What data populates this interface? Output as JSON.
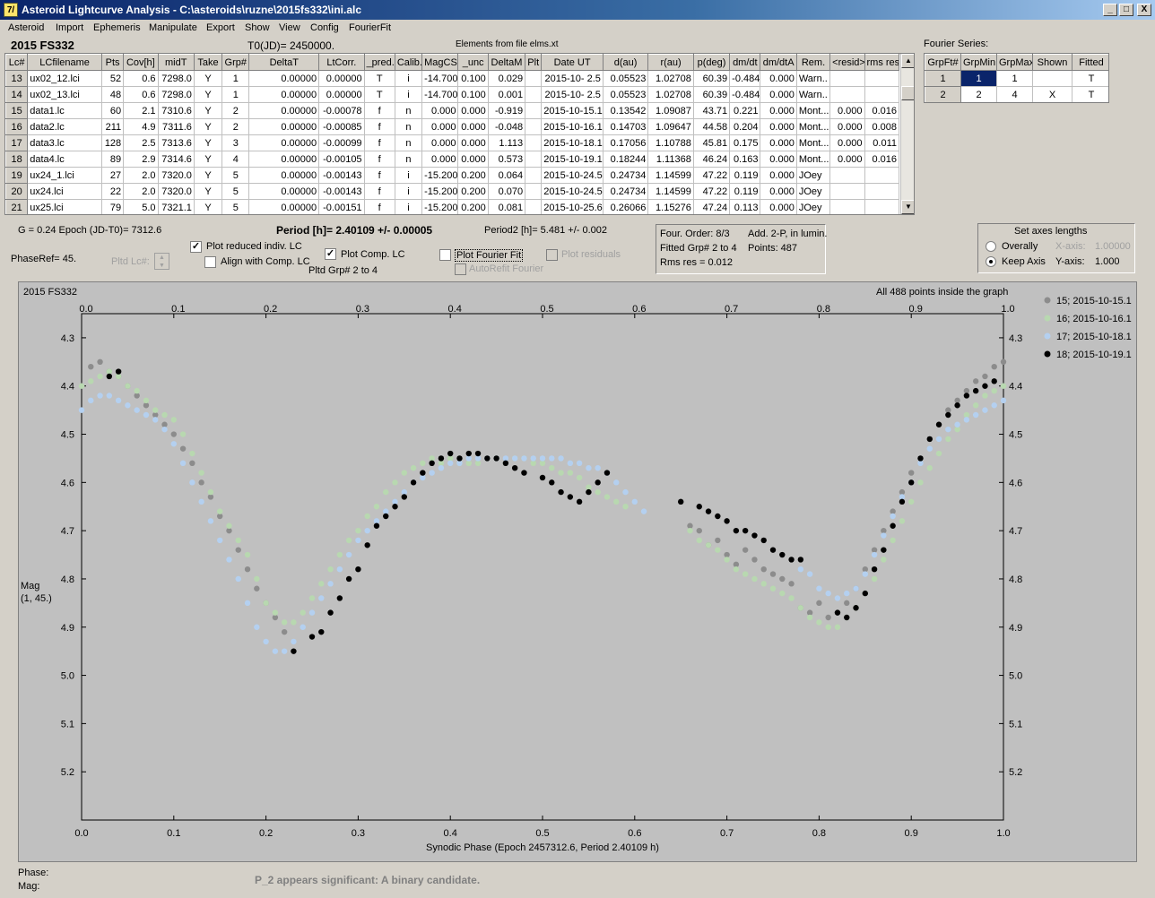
{
  "window": {
    "title": "Asteroid Lightcurve Analysis - C:\\asteroids\\ruzne\\2015fs332\\ini.alc",
    "icon": "7/",
    "minimize": "_",
    "maximize": "□",
    "close": "X"
  },
  "menu": [
    "Asteroid",
    "Import",
    "Ephemeris",
    "Manipulate",
    "Export",
    "Show",
    "View",
    "Config",
    "FourierFit"
  ],
  "header": {
    "asteroid_name": "2015 FS332",
    "t0": "T0(JD)= 2450000.",
    "elements": "Elements from file elms.xt"
  },
  "lc_table": {
    "columns": [
      "Lc#",
      "LCfilename",
      "Pts",
      "Cov[h]",
      "midT",
      "Take",
      "Grp#",
      "DeltaT",
      "LtCorr.",
      "_pred.",
      "Calib.",
      "MagCS",
      "_unc",
      "DeltaM",
      "Plt",
      "Date UT",
      "d(au)",
      "r(au)",
      "p(deg)",
      "dm/dt",
      "dm/dtA",
      "Rem.",
      "<resid>",
      "rms res"
    ],
    "rows": [
      [
        "13",
        "ux02_12.lci",
        "52",
        "0.6",
        "7298.0",
        "Y",
        "1",
        "0.00000",
        "0.00000",
        "T",
        "i",
        "-14.700",
        "0.100",
        "0.029",
        "",
        "2015-10- 2.5",
        "0.05523",
        "1.02708",
        "60.39",
        "-0.484",
        "0.000",
        "Warn..",
        "",
        ""
      ],
      [
        "14",
        "ux02_13.lci",
        "48",
        "0.6",
        "7298.0",
        "Y",
        "1",
        "0.00000",
        "0.00000",
        "T",
        "i",
        "-14.700",
        "0.100",
        "0.001",
        "",
        "2015-10- 2.5",
        "0.05523",
        "1.02708",
        "60.39",
        "-0.484",
        "0.000",
        "Warn..",
        "",
        ""
      ],
      [
        "15",
        "data1.lc",
        "60",
        "2.1",
        "7310.6",
        "Y",
        "2",
        "0.00000",
        "-0.00078",
        "f",
        "n",
        "0.000",
        "0.000",
        "-0.919",
        "",
        "2015-10-15.1",
        "0.13542",
        "1.09087",
        "43.71",
        "0.221",
        "0.000",
        "Mont...",
        "0.000",
        "0.016"
      ],
      [
        "16",
        "data2.lc",
        "211",
        "4.9",
        "7311.6",
        "Y",
        "2",
        "0.00000",
        "-0.00085",
        "f",
        "n",
        "0.000",
        "0.000",
        "-0.048",
        "",
        "2015-10-16.1",
        "0.14703",
        "1.09647",
        "44.58",
        "0.204",
        "0.000",
        "Mont...",
        "0.000",
        "0.008"
      ],
      [
        "17",
        "data3.lc",
        "128",
        "2.5",
        "7313.6",
        "Y",
        "3",
        "0.00000",
        "-0.00099",
        "f",
        "n",
        "0.000",
        "0.000",
        "1.113",
        "",
        "2015-10-18.1",
        "0.17056",
        "1.10788",
        "45.81",
        "0.175",
        "0.000",
        "Mont...",
        "0.000",
        "0.011"
      ],
      [
        "18",
        "data4.lc",
        "89",
        "2.9",
        "7314.6",
        "Y",
        "4",
        "0.00000",
        "-0.00105",
        "f",
        "n",
        "0.000",
        "0.000",
        "0.573",
        "",
        "2015-10-19.1",
        "0.18244",
        "1.11368",
        "46.24",
        "0.163",
        "0.000",
        "Mont...",
        "0.000",
        "0.016"
      ],
      [
        "19",
        "ux24_1.lci",
        "27",
        "2.0",
        "7320.0",
        "Y",
        "5",
        "0.00000",
        "-0.00143",
        "f",
        "i",
        "-15.200",
        "0.200",
        "0.064",
        "",
        "2015-10-24.5",
        "0.24734",
        "1.14599",
        "47.22",
        "0.119",
        "0.000",
        "JOey",
        "",
        ""
      ],
      [
        "20",
        "ux24.lci",
        "22",
        "2.0",
        "7320.0",
        "Y",
        "5",
        "0.00000",
        "-0.00143",
        "f",
        "i",
        "-15.200",
        "0.200",
        "0.070",
        "",
        "2015-10-24.5",
        "0.24734",
        "1.14599",
        "47.22",
        "0.119",
        "0.000",
        "JOey",
        "",
        ""
      ],
      [
        "21",
        "ux25.lci",
        "79",
        "5.0",
        "7321.1",
        "Y",
        "5",
        "0.00000",
        "-0.00151",
        "f",
        "i",
        "-15.200",
        "0.200",
        "0.081",
        "",
        "2015-10-25.6",
        "0.26066",
        "1.15276",
        "47.24",
        "0.113",
        "0.000",
        "JOey",
        "",
        ""
      ]
    ]
  },
  "fourier_series": {
    "title": "Fourier Series:",
    "columns": [
      "GrpFt#",
      "GrpMin",
      "GrpMax",
      "Shown",
      "Fitted"
    ],
    "rows": [
      [
        "1",
        "1",
        "1",
        "",
        "T"
      ],
      [
        "2",
        "2",
        "4",
        "X",
        "T"
      ]
    ]
  },
  "controls": {
    "g_epoch": "G = 0.24    Epoch (JD-T0)= 7312.6",
    "period": "Period [h]= 2.40109 +/- 0.00005",
    "period2": "Period2 [h]= 5.481 +/- 0.002",
    "phase_ref": "PhaseRef= 45.",
    "pltd_lc": "Pltd Lc#:",
    "plot_reduced": "Plot reduced indiv. LC",
    "align_comp": "Align with Comp. LC",
    "plot_comp": "Plot Comp. LC",
    "pltd_grp": "Pltd Grp#  2   to   4",
    "plot_fourier": "Plot Fourier Fit",
    "autorefit": "AutoRefit Fourier",
    "plot_residuals": "Plot residuals"
  },
  "fourier_info": {
    "order": "Four. Order:  8/3",
    "add": "Add. 2-P, in lumin.",
    "fitted": "Fitted Grp# 2 to 4",
    "points": "Points: 487",
    "rms": "Rms res      = 0.012"
  },
  "axes_panel": {
    "title": "Set axes lengths",
    "overally": "Overally",
    "keep_axis": "Keep Axis",
    "x_axis_label": "X-axis:",
    "x_axis_value": "1.00000",
    "y_axis_label": "Y-axis:",
    "y_axis_value": "1.000"
  },
  "graph": {
    "name": "2015 FS332",
    "note": "All 488 points inside the graph",
    "ylabel_1": "Mag",
    "ylabel_2": "(1, 45.)"
  },
  "status": {
    "phase": "Phase:",
    "mag": "Mag:",
    "message": "P_2 appears significant: A binary candidate."
  },
  "chart_data": {
    "type": "scatter",
    "xlabel": "Synodic Phase (Epoch 2457312.6, Period 2.40109 h)",
    "ylabel": "Mag (1, 45.)",
    "xlim": [
      0.0,
      1.0
    ],
    "ylim": [
      5.3,
      4.25
    ],
    "y_inverted": true,
    "x_ticks": [
      "0.0",
      "0.1",
      "0.2",
      "0.3",
      "0.4",
      "0.5",
      "0.6",
      "0.7",
      "0.8",
      "0.9",
      "1.0"
    ],
    "y_ticks": [
      "4.3",
      "4.4",
      "4.5",
      "4.6",
      "4.7",
      "4.8",
      "4.9",
      "5.0",
      "5.1",
      "5.2"
    ],
    "legend_position": "top-right",
    "series": [
      {
        "name": "15; 2015-10-15.1",
        "color": "#8c8c8c",
        "x": [
          0.01,
          0.02,
          0.03,
          0.04,
          0.05,
          0.06,
          0.07,
          0.08,
          0.09,
          0.1,
          0.11,
          0.12,
          0.13,
          0.14,
          0.15,
          0.16,
          0.17,
          0.18,
          0.19,
          0.2,
          0.21,
          0.22,
          0.65,
          0.66,
          0.67,
          0.68,
          0.69,
          0.7,
          0.71,
          0.72,
          0.73,
          0.74,
          0.75,
          0.76,
          0.77,
          0.78,
          0.79,
          0.8,
          0.81,
          0.82,
          0.83,
          0.84,
          0.85,
          0.86,
          0.87,
          0.88,
          0.89,
          0.9,
          0.91,
          0.92,
          0.93,
          0.94,
          0.95,
          0.96,
          0.97,
          0.98,
          0.99,
          1.0
        ],
        "y": [
          4.36,
          4.35,
          4.37,
          4.38,
          4.4,
          4.42,
          4.44,
          4.46,
          4.48,
          4.5,
          4.53,
          4.56,
          4.6,
          4.63,
          4.67,
          4.7,
          4.74,
          4.78,
          4.82,
          4.85,
          4.88,
          4.91,
          4.64,
          4.69,
          4.7,
          4.73,
          4.72,
          4.75,
          4.77,
          4.74,
          4.76,
          4.78,
          4.79,
          4.8,
          4.81,
          4.86,
          4.87,
          4.85,
          4.88,
          4.87,
          4.85,
          4.82,
          4.78,
          4.74,
          4.7,
          4.66,
          4.62,
          4.58,
          4.55,
          4.51,
          4.48,
          4.45,
          4.43,
          4.41,
          4.39,
          4.38,
          4.36,
          4.35
        ]
      },
      {
        "name": "16; 2015-10-16.1",
        "color": "#b8d8b0",
        "x": [
          0.0,
          0.01,
          0.02,
          0.03,
          0.04,
          0.05,
          0.06,
          0.07,
          0.08,
          0.09,
          0.1,
          0.11,
          0.12,
          0.13,
          0.14,
          0.15,
          0.16,
          0.17,
          0.18,
          0.19,
          0.2,
          0.21,
          0.22,
          0.23,
          0.24,
          0.25,
          0.26,
          0.27,
          0.28,
          0.29,
          0.3,
          0.31,
          0.32,
          0.33,
          0.34,
          0.35,
          0.36,
          0.37,
          0.38,
          0.39,
          0.4,
          0.41,
          0.42,
          0.43,
          0.44,
          0.45,
          0.46,
          0.47,
          0.48,
          0.49,
          0.5,
          0.51,
          0.52,
          0.53,
          0.54,
          0.55,
          0.56,
          0.57,
          0.58,
          0.59,
          0.66,
          0.67,
          0.68,
          0.69,
          0.7,
          0.71,
          0.72,
          0.73,
          0.74,
          0.75,
          0.76,
          0.77,
          0.78,
          0.79,
          0.8,
          0.81,
          0.82,
          0.83,
          0.84,
          0.85,
          0.86,
          0.87,
          0.88,
          0.89,
          0.9,
          0.91,
          0.92,
          0.93,
          0.94,
          0.95,
          0.96,
          0.97,
          0.98,
          0.99,
          1.0
        ],
        "y": [
          4.4,
          4.39,
          4.38,
          4.37,
          4.38,
          4.4,
          4.41,
          4.43,
          4.45,
          4.46,
          4.47,
          4.5,
          4.54,
          4.58,
          4.62,
          4.66,
          4.69,
          4.72,
          4.75,
          4.8,
          4.85,
          4.87,
          4.89,
          4.89,
          4.87,
          4.84,
          4.81,
          4.78,
          4.75,
          4.72,
          4.7,
          4.67,
          4.65,
          4.62,
          4.6,
          4.58,
          4.57,
          4.56,
          4.55,
          4.56,
          4.55,
          4.56,
          4.56,
          4.56,
          4.55,
          4.55,
          4.56,
          4.55,
          4.55,
          4.56,
          4.56,
          4.57,
          4.58,
          4.58,
          4.59,
          4.61,
          4.62,
          4.63,
          4.64,
          4.65,
          4.7,
          4.72,
          4.73,
          4.74,
          4.76,
          4.78,
          4.79,
          4.8,
          4.81,
          4.82,
          4.83,
          4.84,
          4.86,
          4.88,
          4.89,
          4.9,
          4.9,
          4.88,
          4.86,
          4.83,
          4.8,
          4.76,
          4.72,
          4.68,
          4.64,
          4.6,
          4.57,
          4.54,
          4.51,
          4.49,
          4.46,
          4.44,
          4.42,
          4.41,
          4.4
        ]
      },
      {
        "name": "17; 2015-10-18.1",
        "color": "#b4d0f0",
        "x": [
          0.0,
          0.01,
          0.02,
          0.03,
          0.04,
          0.05,
          0.06,
          0.07,
          0.08,
          0.09,
          0.1,
          0.11,
          0.12,
          0.13,
          0.14,
          0.15,
          0.16,
          0.17,
          0.18,
          0.19,
          0.2,
          0.21,
          0.22,
          0.23,
          0.24,
          0.25,
          0.26,
          0.27,
          0.28,
          0.29,
          0.3,
          0.31,
          0.32,
          0.33,
          0.34,
          0.35,
          0.36,
          0.37,
          0.38,
          0.39,
          0.4,
          0.41,
          0.42,
          0.43,
          0.44,
          0.45,
          0.46,
          0.47,
          0.48,
          0.49,
          0.5,
          0.51,
          0.52,
          0.53,
          0.54,
          0.55,
          0.56,
          0.57,
          0.58,
          0.59,
          0.6,
          0.61,
          0.78,
          0.79,
          0.8,
          0.81,
          0.82,
          0.83,
          0.84,
          0.85,
          0.86,
          0.87,
          0.88,
          0.89,
          0.9,
          0.91,
          0.92,
          0.93,
          0.94,
          0.95,
          0.96,
          0.97,
          0.98,
          0.99,
          1.0
        ],
        "y": [
          4.45,
          4.43,
          4.42,
          4.42,
          4.43,
          4.44,
          4.45,
          4.46,
          4.47,
          4.49,
          4.52,
          4.56,
          4.6,
          4.64,
          4.68,
          4.72,
          4.76,
          4.8,
          4.85,
          4.9,
          4.93,
          4.95,
          4.95,
          4.93,
          4.9,
          4.87,
          4.84,
          4.81,
          4.78,
          4.75,
          4.72,
          4.7,
          4.68,
          4.66,
          4.64,
          4.62,
          4.6,
          4.59,
          4.58,
          4.57,
          4.56,
          4.56,
          4.55,
          4.55,
          4.55,
          4.55,
          4.55,
          4.55,
          4.55,
          4.55,
          4.55,
          4.55,
          4.55,
          4.56,
          4.56,
          4.57,
          4.57,
          4.58,
          4.6,
          4.62,
          4.64,
          4.66,
          4.78,
          4.79,
          4.82,
          4.83,
          4.84,
          4.83,
          4.82,
          4.79,
          4.75,
          4.71,
          4.67,
          4.63,
          4.6,
          4.56,
          4.53,
          4.51,
          4.49,
          4.48,
          4.47,
          4.46,
          4.45,
          4.44,
          4.43
        ]
      },
      {
        "name": "18; 2015-10-19.1",
        "color": "#000000",
        "x": [
          0.03,
          0.04,
          0.23,
          0.25,
          0.26,
          0.27,
          0.28,
          0.29,
          0.3,
          0.31,
          0.32,
          0.33,
          0.34,
          0.35,
          0.36,
          0.37,
          0.38,
          0.39,
          0.4,
          0.41,
          0.42,
          0.43,
          0.44,
          0.45,
          0.46,
          0.47,
          0.48,
          0.5,
          0.51,
          0.52,
          0.53,
          0.54,
          0.55,
          0.56,
          0.57,
          0.65,
          0.67,
          0.68,
          0.69,
          0.7,
          0.71,
          0.72,
          0.73,
          0.74,
          0.75,
          0.76,
          0.77,
          0.78,
          0.82,
          0.83,
          0.84,
          0.85,
          0.86,
          0.87,
          0.88,
          0.89,
          0.9,
          0.91,
          0.92,
          0.93,
          0.94,
          0.95,
          0.96,
          0.97,
          0.98,
          0.99
        ],
        "y": [
          4.38,
          4.37,
          4.95,
          4.92,
          4.91,
          4.87,
          4.84,
          4.8,
          4.78,
          4.73,
          4.69,
          4.67,
          4.65,
          4.63,
          4.6,
          4.58,
          4.56,
          4.55,
          4.54,
          4.55,
          4.54,
          4.54,
          4.55,
          4.55,
          4.56,
          4.57,
          4.58,
          4.59,
          4.6,
          4.62,
          4.63,
          4.64,
          4.62,
          4.6,
          4.58,
          4.64,
          4.65,
          4.66,
          4.67,
          4.68,
          4.7,
          4.7,
          4.71,
          4.72,
          4.74,
          4.75,
          4.76,
          4.76,
          4.87,
          4.88,
          4.86,
          4.83,
          4.78,
          4.74,
          4.69,
          4.64,
          4.6,
          4.55,
          4.51,
          4.48,
          4.46,
          4.44,
          4.42,
          4.41,
          4.4,
          4.39
        ]
      }
    ]
  }
}
